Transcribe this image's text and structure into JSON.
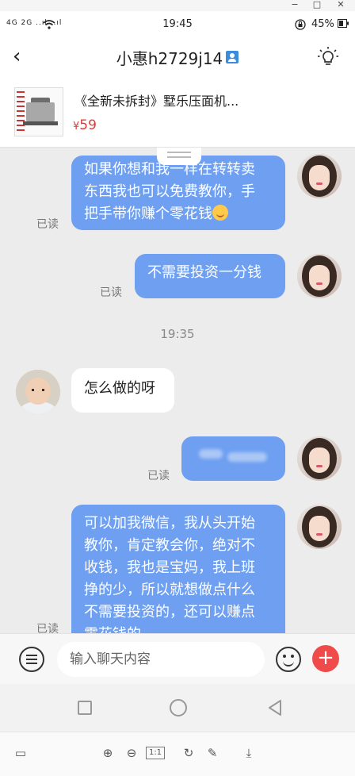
{
  "window": {
    "controls": [
      "−",
      "□",
      "✕"
    ]
  },
  "status": {
    "signal": "4G 2G ..ıl ..ıl",
    "time": "19:45",
    "battery": "45%"
  },
  "header": {
    "back_icon": "‹",
    "title": "小惠h2729j14",
    "profile_icon": "profile-card-icon",
    "bulb_icon": "lightbulb-icon"
  },
  "product": {
    "title": "《全新未拆封》墅乐压面机...",
    "currency": "¥",
    "price": "59"
  },
  "chat": {
    "timestamp": "19:35",
    "messages": [
      {
        "sender": "me",
        "lines": [
          "如果你想和我一样在转转卖",
          "东西我也可以免费教你，手",
          "把手带你赚个零花钱"
        ],
        "emoji": "smiling-face",
        "status": "已读"
      },
      {
        "sender": "me",
        "lines": [
          "不需要投资一分钱"
        ],
        "status": "已读"
      },
      {
        "sender": "them",
        "lines": [
          "怎么做的呀"
        ]
      },
      {
        "sender": "me",
        "lines": [],
        "blurred": true,
        "status": "已读"
      },
      {
        "sender": "me",
        "lines": [
          "可以加我微信，我从头开始",
          "教你，肯定教会你，绝对不",
          "收钱，我也是宝妈，我上班",
          "挣的少，所以就想做点什么",
          "不需要投资的，还可以赚点",
          "零花钱的。"
        ],
        "status": "已读"
      }
    ]
  },
  "input": {
    "placeholder": "输入聊天内容",
    "plus_label": "+"
  },
  "toolbar": {
    "items": [
      "▭",
      "⊕",
      "⊖",
      "1:1",
      "↻",
      "✎",
      "⤓"
    ]
  },
  "colors": {
    "my_bubble": "#6e9ff1",
    "their_bubble": "#ffffff",
    "price": "#e53935",
    "plus_button": "#ef4b4b",
    "background": "#ececec"
  }
}
